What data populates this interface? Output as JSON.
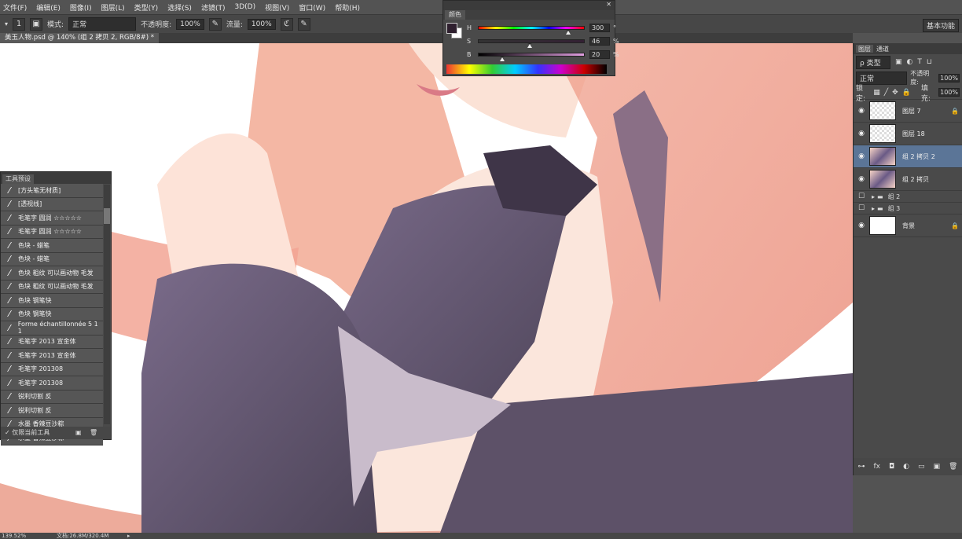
{
  "menu": [
    "文件(F)",
    "编辑(E)",
    "图像(I)",
    "图层(L)",
    "类型(Y)",
    "选择(S)",
    "滤镜(T)",
    "3D(D)",
    "视图(V)",
    "窗口(W)",
    "帮助(H)"
  ],
  "options": {
    "brush_size": "1",
    "mode_label": "模式:",
    "mode_value": "正常",
    "opacity_label": "不透明度:",
    "opacity_value": "100%",
    "flow_label": "流量:",
    "flow_value": "100%"
  },
  "workspace": "基本功能",
  "document_tab": "美玉人物.psd @ 140% (组 2 拷贝 2, RGB/8#) *",
  "color_panel": {
    "title": "颜色",
    "channels": [
      {
        "label": "H",
        "value": "300",
        "unit": "°",
        "pos": 0.83
      },
      {
        "label": "S",
        "value": "46",
        "unit": "%",
        "pos": 0.46
      },
      {
        "label": "B",
        "value": "20",
        "unit": "%",
        "pos": 0.2
      }
    ],
    "foreground": "#2e1f2e",
    "background": "#ffffff"
  },
  "presets_panel": {
    "title": "工具预设",
    "items": [
      "[方头笔无材质]",
      "[透视线]",
      "毛笔字 圆润 ☆☆☆☆☆",
      "毛笔字 圆润 ☆☆☆☆☆",
      "色块 - 蜡笔",
      "色块 - 蜡笔",
      "色块 粗纹 可以画动物 毛发",
      "色块 粗纹 可以画动物 毛发",
      "色块 钢笔快",
      "色块 钢笔快",
      "Forme échantillonnée 5 1 1",
      "毛笔字 2013 宣金体",
      "毛笔字 2013 宣金体",
      "毛笔字 201308",
      "毛笔字 201308",
      "锐利切割 反",
      "锐利切割 反",
      "水墨 香辣豆沙粽",
      "水墨 香辣豆沙粽"
    ],
    "current_tool_only": "仅限当前工具"
  },
  "layers_panel": {
    "tabs": [
      "图层",
      "通道"
    ],
    "filter": "ρ 类型",
    "blend": "正常",
    "opacity_label": "不透明度:",
    "opacity_value": "100%",
    "lock_label": "锁定:",
    "fill_label": "填充:",
    "fill_value": "100%",
    "layers": [
      {
        "name": "图层 7",
        "type": "layer",
        "visible": true,
        "locked": true
      },
      {
        "name": "图层 18",
        "type": "layer",
        "visible": true
      },
      {
        "name": "组 2 拷贝 2",
        "type": "layer",
        "visible": true,
        "selected": true
      },
      {
        "name": "组 2 拷贝",
        "type": "layer",
        "visible": true
      },
      {
        "name": "组 2",
        "type": "group",
        "visible": false
      },
      {
        "name": "组 3",
        "type": "group",
        "visible": false
      },
      {
        "name": "背景",
        "type": "background",
        "visible": true,
        "locked": true
      }
    ]
  },
  "status": {
    "zoom": "139.52%",
    "doc": "文档:26.8M/320.4M"
  }
}
